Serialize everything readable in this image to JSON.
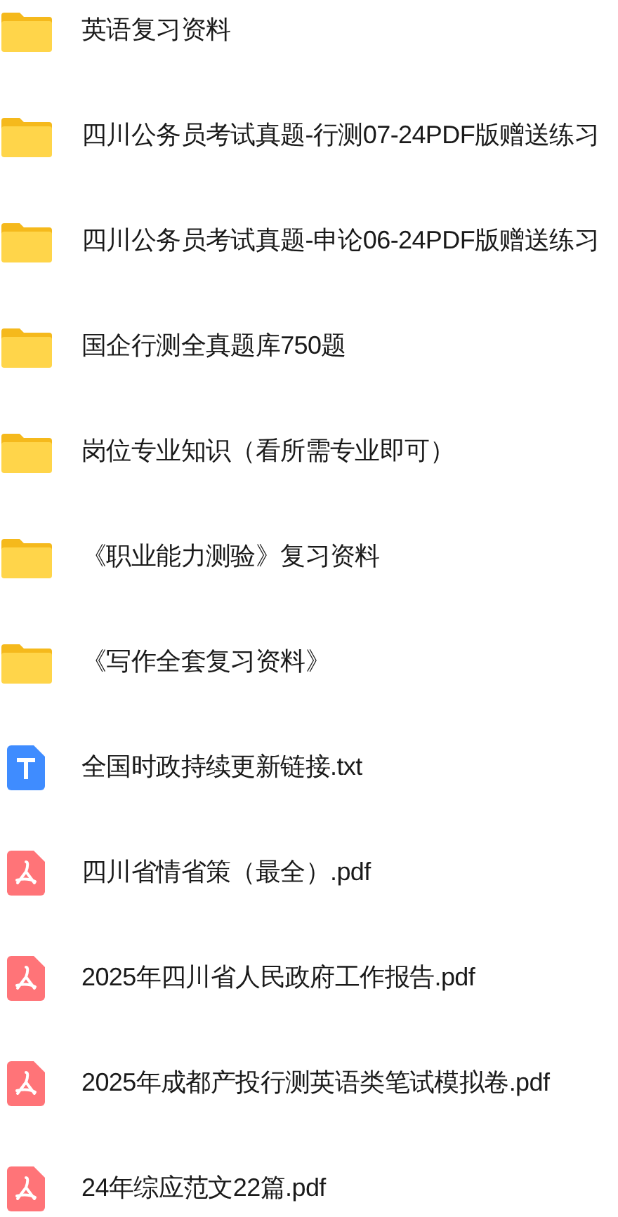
{
  "files": [
    {
      "kind": "folder",
      "name": "英语复习资料"
    },
    {
      "kind": "folder",
      "name": "四川公务员考试真题-行测07-24PDF版赠送练习"
    },
    {
      "kind": "folder",
      "name": "四川公务员考试真题-申论06-24PDF版赠送练习"
    },
    {
      "kind": "folder",
      "name": "国企行测全真题库750题"
    },
    {
      "kind": "folder",
      "name": "岗位专业知识（看所需专业即可）"
    },
    {
      "kind": "folder",
      "name": "《职业能力测验》复习资料"
    },
    {
      "kind": "folder",
      "name": "《写作全套复习资料》"
    },
    {
      "kind": "txt",
      "name": "全国时政持续更新链接.txt"
    },
    {
      "kind": "pdf",
      "name": "四川省情省策（最全）.pdf"
    },
    {
      "kind": "pdf",
      "name": "2025年四川省人民政府工作报告.pdf"
    },
    {
      "kind": "pdf",
      "name": "2025年成都产投行测英语类笔试模拟卷.pdf"
    },
    {
      "kind": "pdf",
      "name": "24年综应范文22篇.pdf"
    }
  ]
}
